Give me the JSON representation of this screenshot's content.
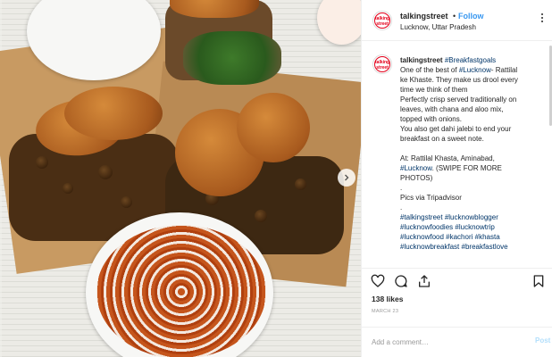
{
  "post": {
    "username": "talkingstreet",
    "follow_separator": "•",
    "follow_label": "Follow",
    "location": "Lucknow, Uttar Pradesh",
    "avatar_text": "talking street"
  },
  "caption": {
    "username": "talkingstreet",
    "hashtag_first": "#Breakfastgoals",
    "lines": [
      "One of the best of ",
      "#Lucknow",
      "- Rattilal",
      "ke Khaste. They make us drool every",
      "time we think of them",
      "Perfectly crisp served traditionally on",
      "leaves, with chana and aloo mix,",
      "topped with onions.",
      "You also get dahi jalebi to end your",
      "breakfast on a sweet note.",
      "At: Rattilal Khasta, Aminabad,",
      "#Lucknow",
      ". (SWIPE FOR MORE",
      "PHOTOS)",
      ".",
      "Pics via Tripadvisor",
      "."
    ],
    "hashtags": [
      "#talkingstreet",
      "#lucknowblogger",
      "#lucknowfoodies",
      "#lucknowtrip",
      "#lucknowfood",
      "#kachori",
      "#khasta",
      "#lucknowbreakfast",
      "#breakfastlove"
    ]
  },
  "engagement": {
    "likes": "138 likes",
    "date": "MARCH 23"
  },
  "comment": {
    "placeholder": "Add a comment…",
    "post_label": "Post"
  },
  "icons": {
    "heart": "heart-icon",
    "comment": "comment-icon",
    "share": "share-icon",
    "save": "bookmark-icon",
    "more": "more-options-icon",
    "next": "chevron-right-icon"
  },
  "colors": {
    "link": "#3897f0",
    "hashtag": "#003569",
    "post_disabled": "#b2dffc",
    "muted": "#999999",
    "text": "#262626"
  }
}
